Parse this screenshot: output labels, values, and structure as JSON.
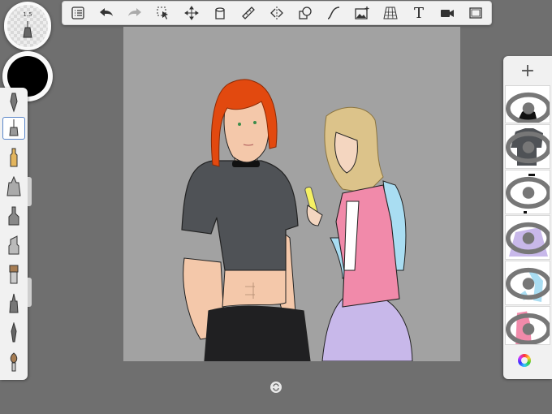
{
  "toolbar": {
    "items": [
      {
        "icon": "list-icon"
      },
      {
        "icon": "undo-icon"
      },
      {
        "icon": "redo-icon"
      },
      {
        "icon": "selection-icon"
      },
      {
        "icon": "transform-icon"
      },
      {
        "icon": "fill-bucket-icon"
      },
      {
        "icon": "ruler-icon"
      },
      {
        "icon": "symmetry-icon"
      },
      {
        "icon": "shapes-icon"
      },
      {
        "icon": "curve-icon"
      },
      {
        "icon": "image-icon"
      },
      {
        "icon": "perspective-grid-icon"
      },
      {
        "icon": "text-icon",
        "label": "T"
      },
      {
        "icon": "video-icon"
      },
      {
        "icon": "fullscreen-icon"
      }
    ]
  },
  "brush": {
    "size": "1.5",
    "color": "#000000"
  },
  "layers": {
    "add_label": "+"
  },
  "colors": {
    "accent": "#5a86c9",
    "canvas": "#a2a2a2",
    "background": "#6f6f6f"
  }
}
